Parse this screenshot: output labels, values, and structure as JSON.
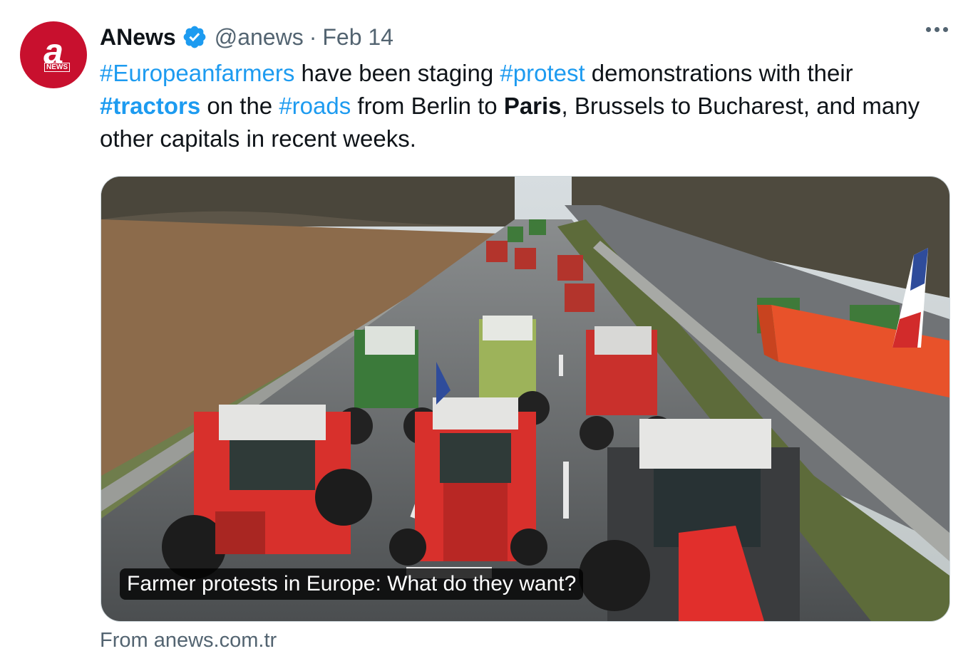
{
  "author": {
    "name": "ANews",
    "handle": "@anews",
    "separator": "·",
    "date": "Feb 14",
    "avatar_letter": "a",
    "avatar_badge": "NEWS",
    "verified_icon": "verified-badge-icon",
    "verified_color": "#1d9bf0"
  },
  "tweet": {
    "segments": [
      {
        "text": "#Europeanfarmers",
        "kind": "hashtag"
      },
      {
        "text": " have been staging ",
        "kind": "plain"
      },
      {
        "text": "#protest",
        "kind": "hashtag"
      },
      {
        "text": " demonstrations with their ",
        "kind": "plain"
      },
      {
        "text": "#tractors",
        "kind": "hashtag-bold"
      },
      {
        "text": " on the ",
        "kind": "plain"
      },
      {
        "text": "#roads",
        "kind": "hashtag"
      },
      {
        "text": " from Berlin to ",
        "kind": "plain"
      },
      {
        "text": "Paris",
        "kind": "bold"
      },
      {
        "text": ", Brussels to Bucharest, and many other capitals in recent weeks.",
        "kind": "plain"
      }
    ]
  },
  "card": {
    "caption": "Farmer protests in Europe: What do they want?",
    "source": "From anews.com.tr",
    "image_subject": "tractors blocking a highway"
  },
  "colors": {
    "link": "#1d9bf0",
    "text": "#0f1419",
    "secondary": "#536471",
    "brand": "#c8102e"
  },
  "menu": {
    "icon": "more-options-icon"
  }
}
